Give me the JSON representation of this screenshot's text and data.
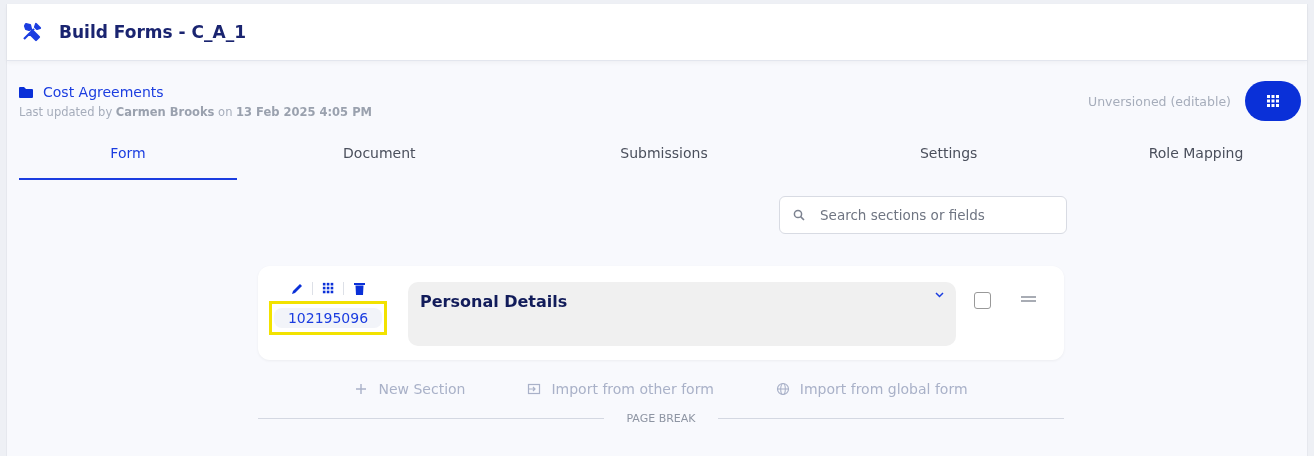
{
  "header": {
    "title": "Build Forms - C_A_1"
  },
  "info": {
    "folder": "Cost Agreements",
    "updated_prefix": "Last updated by",
    "updated_by": "Carmen Brooks",
    "updated_on_word": "on",
    "updated_on": "13 Feb 2025 4:05 PM",
    "version": "Unversioned (editable)"
  },
  "tabs": [
    {
      "label": "Form",
      "selected": true
    },
    {
      "label": "Document",
      "selected": false
    },
    {
      "label": "Submissions",
      "selected": false
    },
    {
      "label": "Settings",
      "selected": false
    },
    {
      "label": "Role Mapping",
      "selected": false
    }
  ],
  "search": {
    "placeholder": "Search sections or fields"
  },
  "sections": [
    {
      "id": "102195096",
      "title": "Personal Details",
      "checked": false,
      "highlighted": true
    }
  ],
  "actions": [
    {
      "kind": "new",
      "label": "New Section"
    },
    {
      "kind": "import",
      "label": "Import from other form"
    },
    {
      "kind": "global",
      "label": "Import from global form"
    }
  ],
  "page_break": "PAGE BREAK"
}
